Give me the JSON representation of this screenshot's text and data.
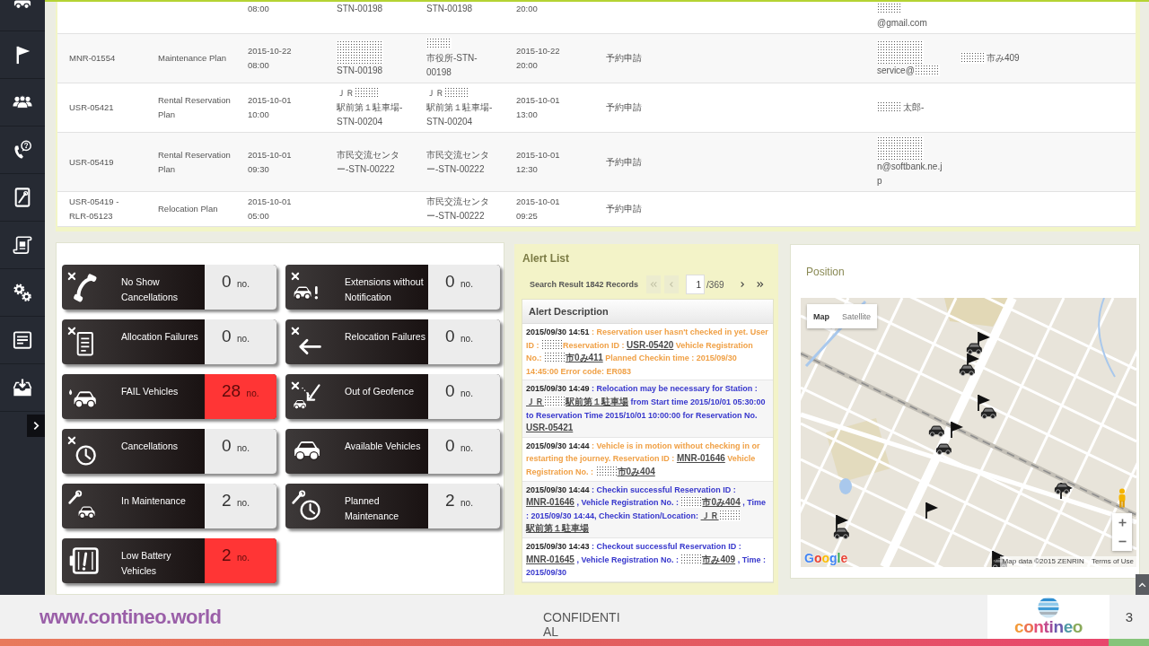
{
  "table": {
    "rows": [
      {
        "column_3": "08:00",
        "column_4": "STN-00198",
        "column_5": "STN-00198",
        "column_6": "20:00",
        "column_8": [
          {
            "kind": "mask"
          },
          {
            "kind": "text",
            "text": "@gmail.com"
          }
        ]
      },
      {
        "column_1": "MNR-01554",
        "column_2": "Maintenance Plan",
        "column_3": "2015-10-22\n08:00",
        "column_4": [
          {
            "kind": "mask-block"
          },
          {
            "kind": "text",
            "text": "STN-00198"
          }
        ],
        "column_5": [
          {
            "kind": "mask"
          },
          {
            "kind": "text",
            "text": "市役所-STN-00198"
          }
        ],
        "column_6": "2015-10-22\n20:00",
        "column_7": "予約申請",
        "column_8": [
          {
            "kind": "mask-block"
          },
          {
            "kind": "text",
            "text": "service@"
          },
          {
            "kind": "mask"
          }
        ],
        "column_9": [
          {
            "kind": "mask"
          },
          {
            "kind": "text",
            "text": "市み409"
          }
        ]
      },
      {
        "column_1": "USR-05421",
        "column_2": "Rental Reservation Plan",
        "column_3": "2015-10-01\n10:00",
        "column_4": [
          {
            "kind": "text",
            "text": "ＪＲ"
          },
          {
            "kind": "mask"
          },
          {
            "kind": "text",
            "text": "駅前第１駐車場-STN-00204"
          }
        ],
        "column_5": [
          {
            "kind": "text",
            "text": "ＪＲ"
          },
          {
            "kind": "mask"
          },
          {
            "kind": "text",
            "text": "駅前第１駐車場-STN-00204"
          }
        ],
        "column_6": "2015-10-01\n13:00",
        "column_7": "予約申請",
        "column_8": [
          {
            "kind": "mask"
          },
          {
            "kind": "text",
            "text": "太郎-"
          }
        ]
      },
      {
        "column_1": "USR-05419",
        "column_2": "Rental Reservation Plan",
        "column_3": "2015-10-01\n09:30",
        "column_4": "市民交流センター-STN-00222",
        "column_5": "市民交流センター-STN-00222",
        "column_6": "2015-10-01\n12:30",
        "column_7": "予約申請",
        "column_8": [
          {
            "kind": "mask-block"
          },
          {
            "kind": "text",
            "text": "n@softbank.ne.jp"
          }
        ]
      },
      {
        "column_1": "USR-05419 - RLR-05123",
        "column_2": "Relocation Plan",
        "column_3": "2015-10-01\n05:00",
        "column_5": "市民交流センター-STN-00222",
        "column_6": "2015-10-01\n09:25",
        "column_7": "予約申請"
      }
    ]
  },
  "tiles": [
    {
      "label": "No Show Cancellations",
      "count": "0",
      "unit": "no.",
      "highlighted": false
    },
    {
      "label": "Extensions without Notification",
      "count": "0",
      "unit": "no.",
      "highlighted": false
    },
    {
      "label": "Allocation Failures",
      "count": "0",
      "unit": "no.",
      "highlighted": false
    },
    {
      "label": "Relocation Failures",
      "count": "0",
      "unit": "no.",
      "highlighted": false
    },
    {
      "label": "FAIL Vehicles",
      "count": "28",
      "unit": "no.",
      "highlighted": true
    },
    {
      "label": "Out of Geofence",
      "count": "0",
      "unit": "no.",
      "highlighted": false
    },
    {
      "label": "Cancellations",
      "count": "0",
      "unit": "no.",
      "highlighted": false
    },
    {
      "label": "Available Vehicles",
      "count": "0",
      "unit": "no.",
      "highlighted": false
    },
    {
      "label": "In Maintenance",
      "count": "2",
      "unit": "no.",
      "highlighted": false
    },
    {
      "label": "Planned Maintenance",
      "count": "2",
      "unit": "no.",
      "highlighted": false
    },
    {
      "label": "Low Battery Vehicles",
      "count": "2",
      "unit": "no.",
      "highlighted": true
    }
  ],
  "alert_list": {
    "title": "Alert List",
    "summary": "Search Result 1842 Records",
    "pager": {
      "first": {
        "disabled": true
      },
      "previous": {
        "disabled": true
      },
      "page": "1",
      "total": "/369",
      "next": {
        "disabled": false
      },
      "last": {
        "disabled": false
      }
    },
    "column": "Alert Description",
    "alerts": [
      {
        "time": "2015/09/30 14:51",
        "color": "#f0a045",
        "parts": [
          {
            "kind": "text",
            "text": ": Reservation user hasn't checked in yet. User ID : "
          },
          {
            "kind": "mask"
          },
          {
            "kind": "text",
            "text": "Reservation ID : "
          },
          {
            "kind": "link",
            "text": "USR-05420"
          },
          {
            "kind": "text",
            "text": " Vehicle Registration No.: "
          },
          {
            "kind": "mask"
          },
          {
            "kind": "link",
            "text": "市0み411"
          },
          {
            "kind": "text",
            "text": " Planned Checkin time : 2015/09/30 14:45:00 Error code: ER083"
          }
        ]
      },
      {
        "time": "2015/09/30 14:49",
        "color": "#3636cc",
        "parts": [
          {
            "kind": "text",
            "text": ": Relocation may be necessary for Station : "
          },
          {
            "kind": "link",
            "text": "ＪＲ"
          },
          {
            "kind": "mask"
          },
          {
            "kind": "link",
            "text": "駅前第１駐車場"
          },
          {
            "kind": "text",
            "text": " from Start time 2015/10/01 05:30:00 to Reservation Time 2015/10/01 10:00:00 for Reservation No. "
          },
          {
            "kind": "link",
            "text": "USR-05421"
          }
        ]
      },
      {
        "time": "2015/09/30 14:44",
        "color": "#f0a045",
        "parts": [
          {
            "kind": "text",
            "text": ": Vehicle is in motion without checking in or restarting the journey. Reservation ID : "
          },
          {
            "kind": "link",
            "text": "MNR-01646"
          },
          {
            "kind": "text",
            "text": " Vehicle Registration No. : "
          },
          {
            "kind": "mask"
          },
          {
            "kind": "link",
            "text": "市0み404"
          }
        ]
      },
      {
        "time": "2015/09/30 14:44",
        "color": "#3636cc",
        "parts": [
          {
            "kind": "text",
            "text": ": Checkin successful Reservation ID : "
          },
          {
            "kind": "link",
            "text": "MNR-01646"
          },
          {
            "kind": "text",
            "text": " , Vehicle Registration No. : "
          },
          {
            "kind": "mask"
          },
          {
            "kind": "link",
            "text": "市0み404"
          },
          {
            "kind": "text",
            "text": " , Time : 2015/09/30 14:44, Checkin Station/Location: "
          },
          {
            "kind": "link",
            "text": "ＪＲ"
          },
          {
            "kind": "mask"
          },
          {
            "kind": "link",
            "text": "駅前第１駐車場"
          }
        ]
      },
      {
        "time": "2015/09/30 14:43",
        "color": "#3636cc",
        "parts": [
          {
            "kind": "text",
            "text": ": Checkout successful Reservation ID : "
          },
          {
            "kind": "link",
            "text": "MNR-01645"
          },
          {
            "kind": "text",
            "text": " , Vehicle Registration No. : "
          },
          {
            "kind": "mask"
          },
          {
            "kind": "link",
            "text": "市み409"
          },
          {
            "kind": "text",
            "text": " , Time : 2015/09/30"
          }
        ]
      }
    ]
  },
  "position_panel": {
    "title": "Position",
    "map_types": [
      {
        "label": "Map",
        "selected": true
      },
      {
        "label": "Satellite",
        "selected": false
      }
    ],
    "logo": "Google",
    "attribution": "Map data ©2015 ZENRIN",
    "terms": "Terms of Use"
  },
  "footer": {
    "website": "www.contineo.world",
    "notice": "CONFIDENTIAL",
    "brand": "contineo",
    "page_number": "3"
  }
}
